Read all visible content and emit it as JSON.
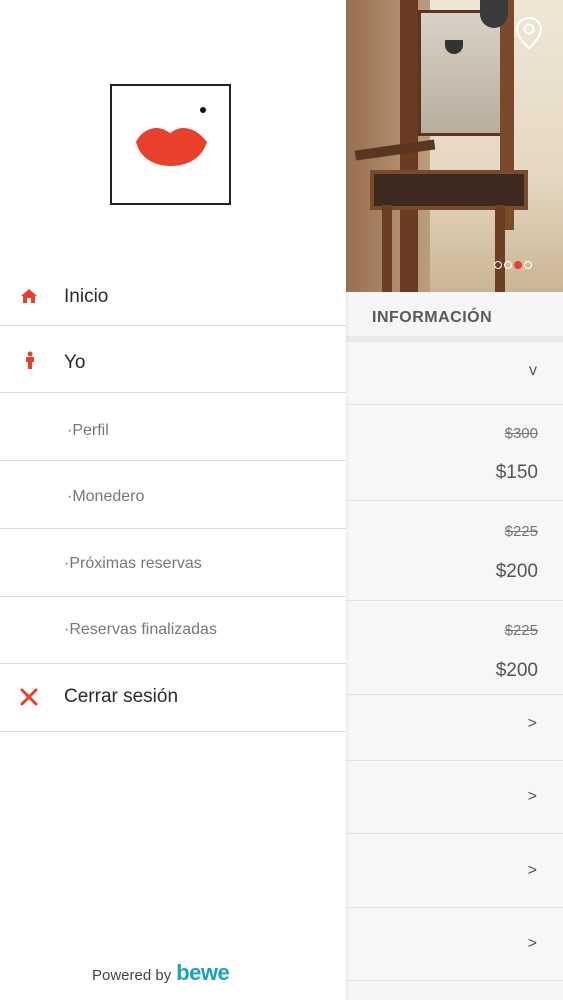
{
  "colors": {
    "accent": "#e8402a",
    "brand": "#1aa3b8"
  },
  "drawer": {
    "logo_icon": "lips-icon",
    "items": [
      {
        "label": "Inicio",
        "icon": "home-icon"
      },
      {
        "label": "Yo",
        "icon": "person-icon"
      },
      {
        "label": "·Perfil"
      },
      {
        "label": "·Monedero"
      },
      {
        "label": "·Próximas reservas"
      },
      {
        "label": "·Reservas finalizadas"
      },
      {
        "label": "Cerrar sesión",
        "icon": "close-icon"
      }
    ],
    "footer": {
      "powered_by": "Powered by",
      "brand": "bewe"
    }
  },
  "page": {
    "carousel": {
      "total": 4,
      "active_index": 2
    },
    "section_title": "INFORMACIÓN",
    "prices": [
      {
        "old": "$300",
        "new": "$150"
      },
      {
        "old": "$225",
        "new": "$200"
      },
      {
        "old": "$225",
        "new": "$200"
      }
    ],
    "chevron_down": "v",
    "chevron_right": ">"
  }
}
